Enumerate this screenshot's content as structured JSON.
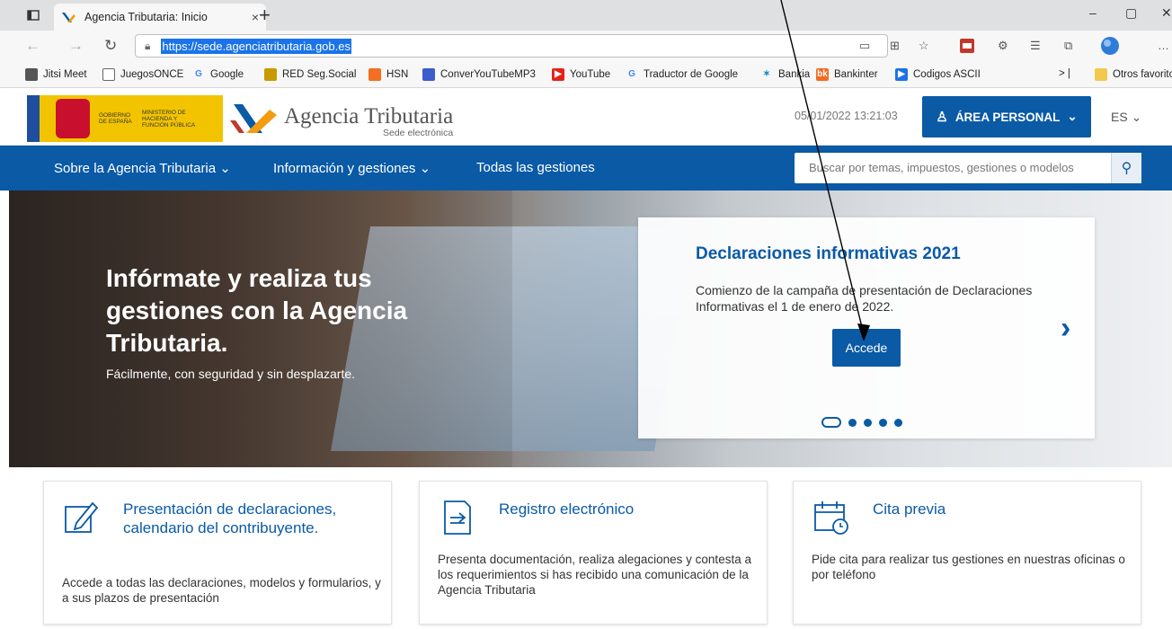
{
  "browser": {
    "tab_title": "Agencia Tributaria: Inicio",
    "tab_close": "×",
    "new_tab": "+",
    "url": "https://sede.agenciatributaria.gob.es",
    "window_controls": [
      "–",
      "▢",
      "✕"
    ]
  },
  "bookmarks": [
    {
      "label": "Jitsi Meet",
      "icon": "feather-icon",
      "color": "#555555"
    },
    {
      "label": "JuegosONCE",
      "icon": "page-icon",
      "color": "#555555"
    },
    {
      "label": "Google",
      "icon": "google-icon",
      "color": "#4285f4"
    },
    {
      "label": "RED Seg.Social",
      "icon": "red-icon",
      "color": "#c99a00"
    },
    {
      "label": "HSN",
      "icon": "hsn-icon",
      "color": "#f36f21"
    },
    {
      "label": "ConverYouTubeMP3",
      "icon": "convert-icon",
      "color": "#3a5ccc"
    },
    {
      "label": "YouTube",
      "icon": "youtube-icon",
      "color": "#e62117"
    },
    {
      "label": "Traductor de Google",
      "icon": "google-icon",
      "color": "#4285f4"
    },
    {
      "label": "Bankia",
      "icon": "bankia-icon",
      "color": "#1e87c8"
    },
    {
      "label": "Bankinter",
      "icon": "bankinter-icon",
      "color": "#f26b21"
    },
    {
      "label": "Codigos ASCII",
      "icon": "ascii-icon",
      "color": "#1a73e8"
    }
  ],
  "bookmarks_more": "Otros favorito",
  "header": {
    "gob_line1": "GOBIERNO DE ESPAÑA",
    "ministry": "MINISTERIO DE HACIENDA Y FUNCIÓN PÚBLICA",
    "brand": "Agencia Tributaria",
    "brand_sub": "Sede electrónica",
    "datetime": "05/01/2022 13:21:03",
    "area_personal": "ÁREA PERSONAL",
    "lang": "ES"
  },
  "nav": {
    "items": [
      "Sobre la Agencia Tributaria",
      "Información y gestiones",
      "Todas las gestiones"
    ],
    "search_placeholder": "Buscar por temas, impuestos, gestiones o modelos"
  },
  "hero": {
    "title": "Infórmate y realiza tus gestiones con la Agencia Tributaria.",
    "subtitle": "Fácilmente, con seguridad y sin desplazarte.",
    "slide_title": "Declaraciones informativas 2021",
    "slide_text": "Comienzo de la campaña de presentación de Declaraciones Informativas el 1 de enero de 2022.",
    "slide_button": "Accede",
    "slide_count": 5,
    "active_slide": 1
  },
  "cards": [
    {
      "icon": "edit-icon",
      "title": "Presentación de declaraciones, calendario del contribuyente.",
      "desc": "Accede a todas las declaraciones, modelos y formularios, y a sus plazos de presentación"
    },
    {
      "icon": "document-icon",
      "title": "Registro electrónico",
      "desc": "Presenta documentación, realiza alegaciones y contesta a los requerimientos si has recibido una comunicación de la Agencia Tributaria"
    },
    {
      "icon": "calendar-clock-icon",
      "title": "Cita previa",
      "desc": "Pide cita para realizar tus gestiones en nuestras oficinas o por teléfono"
    }
  ],
  "colors": {
    "primary": "#0a5aa6",
    "gov_yellow": "#f2c400"
  }
}
